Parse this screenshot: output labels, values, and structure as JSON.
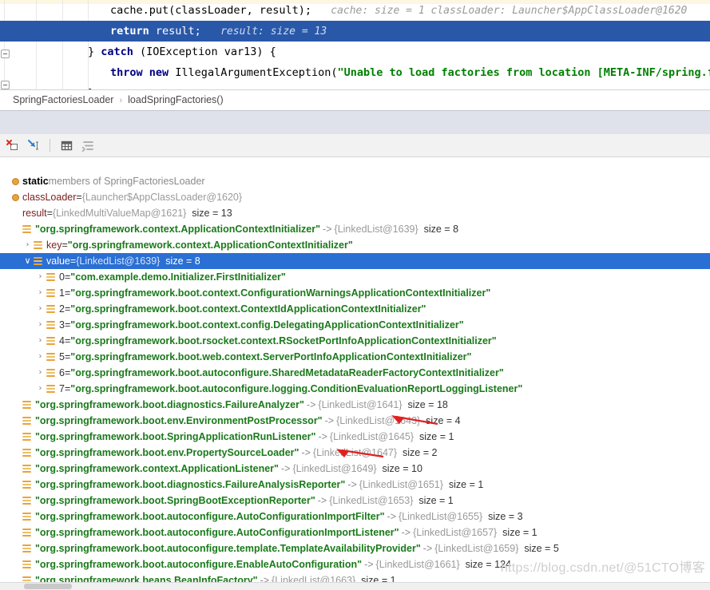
{
  "editor": {
    "lines": [
      {
        "id": "cache-put",
        "selected": false,
        "code": "cache.put(classLoader, result);",
        "hint": "cache:  size = 1    classLoader: Launcher$AppClassLoader@1620"
      },
      {
        "id": "return-result",
        "selected": true,
        "code": "return result;",
        "hint": "result:  size = 13"
      },
      {
        "id": "catch-line",
        "selected": false,
        "code": "} catch (IOException var13) {",
        "hint": ""
      },
      {
        "id": "throw-line",
        "selected": false,
        "code": "throw new IllegalArgumentException(\"Unable to load factories from location [META-INF/spring.fa",
        "hint": ""
      },
      {
        "id": "close-brace",
        "selected": false,
        "code": "}",
        "hint": ""
      }
    ],
    "keywords": {
      "return": "return",
      "catch": "catch",
      "throw": "throw",
      "new": "new"
    }
  },
  "breadcrumb": {
    "items": [
      "SpringFactoriesLoader",
      "loadSpringFactories()"
    ],
    "separator": "›"
  },
  "toolbar": {
    "buttons": [
      {
        "name": "remove-watch-icon",
        "title": "Remove Watch"
      },
      {
        "name": "jump-to-source-icon",
        "title": "Jump To Source"
      },
      {
        "name": "view-as-table-icon",
        "title": "View as Table"
      },
      {
        "name": "sort-values-icon",
        "title": "Sort Values"
      }
    ]
  },
  "variables": {
    "rows": [
      {
        "indent": 0,
        "arrow": "",
        "icon": "field",
        "selected": false,
        "name": "static",
        "name_style": "static",
        "suffix_grey": " members of SpringFactoriesLoader",
        "eq": "",
        "value": "",
        "ref": "",
        "size": ""
      },
      {
        "indent": 0,
        "arrow": "",
        "icon": "field",
        "selected": false,
        "name": "classLoader",
        "name_style": "key",
        "suffix_grey": "",
        "eq": " = ",
        "ref": "{Launcher$AppClassLoader@1620}",
        "value": "",
        "size": ""
      },
      {
        "indent": 0,
        "arrow": "",
        "icon": "none",
        "selected": false,
        "name": "result",
        "name_style": "key",
        "suffix_grey": "",
        "eq": " = ",
        "ref": "{LinkedMultiValueMap@1621}",
        "value": "",
        "size": "size = 13"
      },
      {
        "indent": 1,
        "arrow": "",
        "icon": "list",
        "selected": false,
        "name": "",
        "name_style": "key",
        "suffix_grey": "",
        "eq": "",
        "value": "\"org.springframework.context.ApplicationContextInitializer\"",
        "map": " -> ",
        "ref": "{LinkedList@1639}",
        "size": "size = 8"
      },
      {
        "indent": 2,
        "arrow": "›",
        "icon": "list",
        "selected": false,
        "name": "key",
        "name_style": "key",
        "suffix_grey": "",
        "eq": " = ",
        "value": "\"org.springframework.context.ApplicationContextInitializer\"",
        "ref": "",
        "size": "",
        "red_arrow": true
      },
      {
        "indent": 2,
        "arrow": "∨",
        "icon": "list",
        "selected": true,
        "name": "value",
        "name_style": "key",
        "suffix_grey": "",
        "eq": " = ",
        "value": "",
        "ref": "{LinkedList@1639}",
        "size": "size = 8"
      },
      {
        "indent": 3,
        "arrow": "›",
        "icon": "list",
        "selected": false,
        "name": "0",
        "name_style": "num",
        "suffix_grey": "",
        "eq": " = ",
        "value": "\"com.example.demo.Initializer.FirstInitializer\"",
        "ref": "",
        "size": "",
        "red_arrow": true
      },
      {
        "indent": 3,
        "arrow": "›",
        "icon": "list",
        "selected": false,
        "name": "1",
        "name_style": "num",
        "suffix_grey": "",
        "eq": " = ",
        "value": "\"org.springframework.boot.context.ConfigurationWarningsApplicationContextInitializer\"",
        "ref": "",
        "size": ""
      },
      {
        "indent": 3,
        "arrow": "›",
        "icon": "list",
        "selected": false,
        "name": "2",
        "name_style": "num",
        "suffix_grey": "",
        "eq": " = ",
        "value": "\"org.springframework.boot.context.ContextIdApplicationContextInitializer\"",
        "ref": "",
        "size": ""
      },
      {
        "indent": 3,
        "arrow": "›",
        "icon": "list",
        "selected": false,
        "name": "3",
        "name_style": "num",
        "suffix_grey": "",
        "eq": " = ",
        "value": "\"org.springframework.boot.context.config.DelegatingApplicationContextInitializer\"",
        "ref": "",
        "size": ""
      },
      {
        "indent": 3,
        "arrow": "›",
        "icon": "list",
        "selected": false,
        "name": "4",
        "name_style": "num",
        "suffix_grey": "",
        "eq": " = ",
        "value": "\"org.springframework.boot.rsocket.context.RSocketPortInfoApplicationContextInitializer\"",
        "ref": "",
        "size": ""
      },
      {
        "indent": 3,
        "arrow": "›",
        "icon": "list",
        "selected": false,
        "name": "5",
        "name_style": "num",
        "suffix_grey": "",
        "eq": " = ",
        "value": "\"org.springframework.boot.web.context.ServerPortInfoApplicationContextInitializer\"",
        "ref": "",
        "size": ""
      },
      {
        "indent": 3,
        "arrow": "›",
        "icon": "list",
        "selected": false,
        "name": "6",
        "name_style": "num",
        "suffix_grey": "",
        "eq": " = ",
        "value": "\"org.springframework.boot.autoconfigure.SharedMetadataReaderFactoryContextInitializer\"",
        "ref": "",
        "size": ""
      },
      {
        "indent": 3,
        "arrow": "›",
        "icon": "list",
        "selected": false,
        "name": "7",
        "name_style": "num",
        "suffix_grey": "",
        "eq": " = ",
        "value": "\"org.springframework.boot.autoconfigure.logging.ConditionEvaluationReportLoggingListener\"",
        "ref": "",
        "size": ""
      },
      {
        "indent": 1,
        "arrow": "",
        "icon": "list",
        "selected": false,
        "name": "",
        "name_style": "key",
        "suffix_grey": "",
        "eq": "",
        "value": "\"org.springframework.boot.diagnostics.FailureAnalyzer\"",
        "map": " -> ",
        "ref": "{LinkedList@1641}",
        "size": "size = 18"
      },
      {
        "indent": 1,
        "arrow": "",
        "icon": "list",
        "selected": false,
        "name": "",
        "name_style": "key",
        "suffix_grey": "",
        "eq": "",
        "value": "\"org.springframework.boot.env.EnvironmentPostProcessor\"",
        "map": " -> ",
        "ref": "{LinkedList@1643}",
        "size": "size = 4"
      },
      {
        "indent": 1,
        "arrow": "",
        "icon": "list",
        "selected": false,
        "name": "",
        "name_style": "key",
        "suffix_grey": "",
        "eq": "",
        "value": "\"org.springframework.boot.SpringApplicationRunListener\"",
        "map": " -> ",
        "ref": "{LinkedList@1645}",
        "size": "size = 1"
      },
      {
        "indent": 1,
        "arrow": "",
        "icon": "list",
        "selected": false,
        "name": "",
        "name_style": "key",
        "suffix_grey": "",
        "eq": "",
        "value": "\"org.springframework.boot.env.PropertySourceLoader\"",
        "map": " -> ",
        "ref": "{LinkedList@1647}",
        "size": "size = 2"
      },
      {
        "indent": 1,
        "arrow": "",
        "icon": "list",
        "selected": false,
        "name": "",
        "name_style": "key",
        "suffix_grey": "",
        "eq": "",
        "value": "\"org.springframework.context.ApplicationListener\"",
        "map": " -> ",
        "ref": "{LinkedList@1649}",
        "size": "size = 10"
      },
      {
        "indent": 1,
        "arrow": "",
        "icon": "list",
        "selected": false,
        "name": "",
        "name_style": "key",
        "suffix_grey": "",
        "eq": "",
        "value": "\"org.springframework.boot.diagnostics.FailureAnalysisReporter\"",
        "map": " -> ",
        "ref": "{LinkedList@1651}",
        "size": "size = 1"
      },
      {
        "indent": 1,
        "arrow": "",
        "icon": "list",
        "selected": false,
        "name": "",
        "name_style": "key",
        "suffix_grey": "",
        "eq": "",
        "value": "\"org.springframework.boot.SpringBootExceptionReporter\"",
        "map": " -> ",
        "ref": "{LinkedList@1653}",
        "size": "size = 1"
      },
      {
        "indent": 1,
        "arrow": "",
        "icon": "list",
        "selected": false,
        "name": "",
        "name_style": "key",
        "suffix_grey": "",
        "eq": "",
        "value": "\"org.springframework.boot.autoconfigure.AutoConfigurationImportFilter\"",
        "map": " -> ",
        "ref": "{LinkedList@1655}",
        "size": "size = 3"
      },
      {
        "indent": 1,
        "arrow": "",
        "icon": "list",
        "selected": false,
        "name": "",
        "name_style": "key",
        "suffix_grey": "",
        "eq": "",
        "value": "\"org.springframework.boot.autoconfigure.AutoConfigurationImportListener\"",
        "map": " -> ",
        "ref": "{LinkedList@1657}",
        "size": "size = 1"
      },
      {
        "indent": 1,
        "arrow": "",
        "icon": "list",
        "selected": false,
        "name": "",
        "name_style": "key",
        "suffix_grey": "",
        "eq": "",
        "value": "\"org.springframework.boot.autoconfigure.template.TemplateAvailabilityProvider\"",
        "map": " -> ",
        "ref": "{LinkedList@1659}",
        "size": "size = 5"
      },
      {
        "indent": 1,
        "arrow": "",
        "icon": "list",
        "selected": false,
        "name": "",
        "name_style": "key",
        "suffix_grey": "",
        "eq": "",
        "value": "\"org.springframework.boot.autoconfigure.EnableAutoConfiguration\"",
        "map": " -> ",
        "ref": "{LinkedList@1661}",
        "size": "size = 124"
      },
      {
        "indent": 1,
        "arrow": "",
        "icon": "list",
        "selected": false,
        "name": "",
        "name_style": "key",
        "suffix_grey": "",
        "eq": "",
        "value": "\"org.springframework.beans.BeanInfoFactory\"",
        "map": " -> ",
        "ref": "{LinkedList@1663}",
        "size": "size = 1"
      }
    ]
  },
  "watermark": {
    "text": "https://blog.csdn.net/@51CTO博客"
  },
  "colors": {
    "selection_blue": "#2a6fd4",
    "code_selection_blue": "#2a58a8",
    "string_green": "#1a7a1a",
    "keyword_navy": "#000080",
    "icon_orange": "#e8a33d",
    "arrow_red": "#e02020"
  }
}
